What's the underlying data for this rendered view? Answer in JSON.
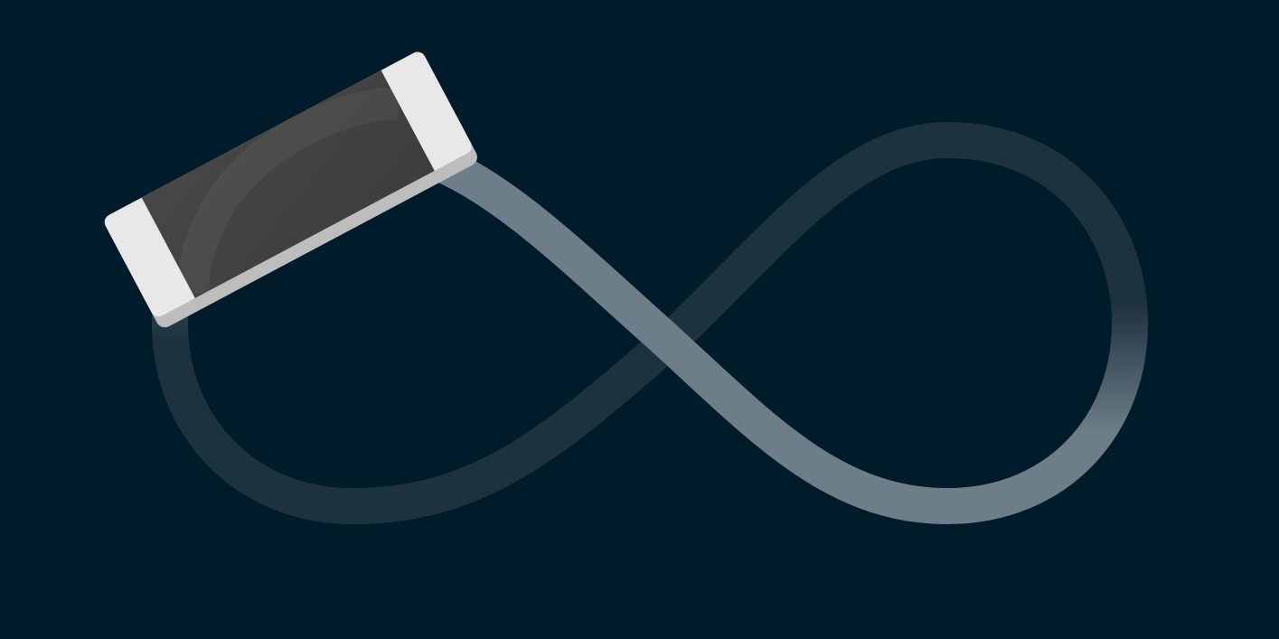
{
  "scene": {
    "subject": "phone-on-infinity-path",
    "colors": {
      "background": "#001b2a",
      "path_faint": "#1d323f",
      "path_bright": "#6e7e88",
      "phone_body": "#e8e8e8",
      "phone_edge": "#bdbdbd",
      "phone_screen": "#414141"
    }
  }
}
